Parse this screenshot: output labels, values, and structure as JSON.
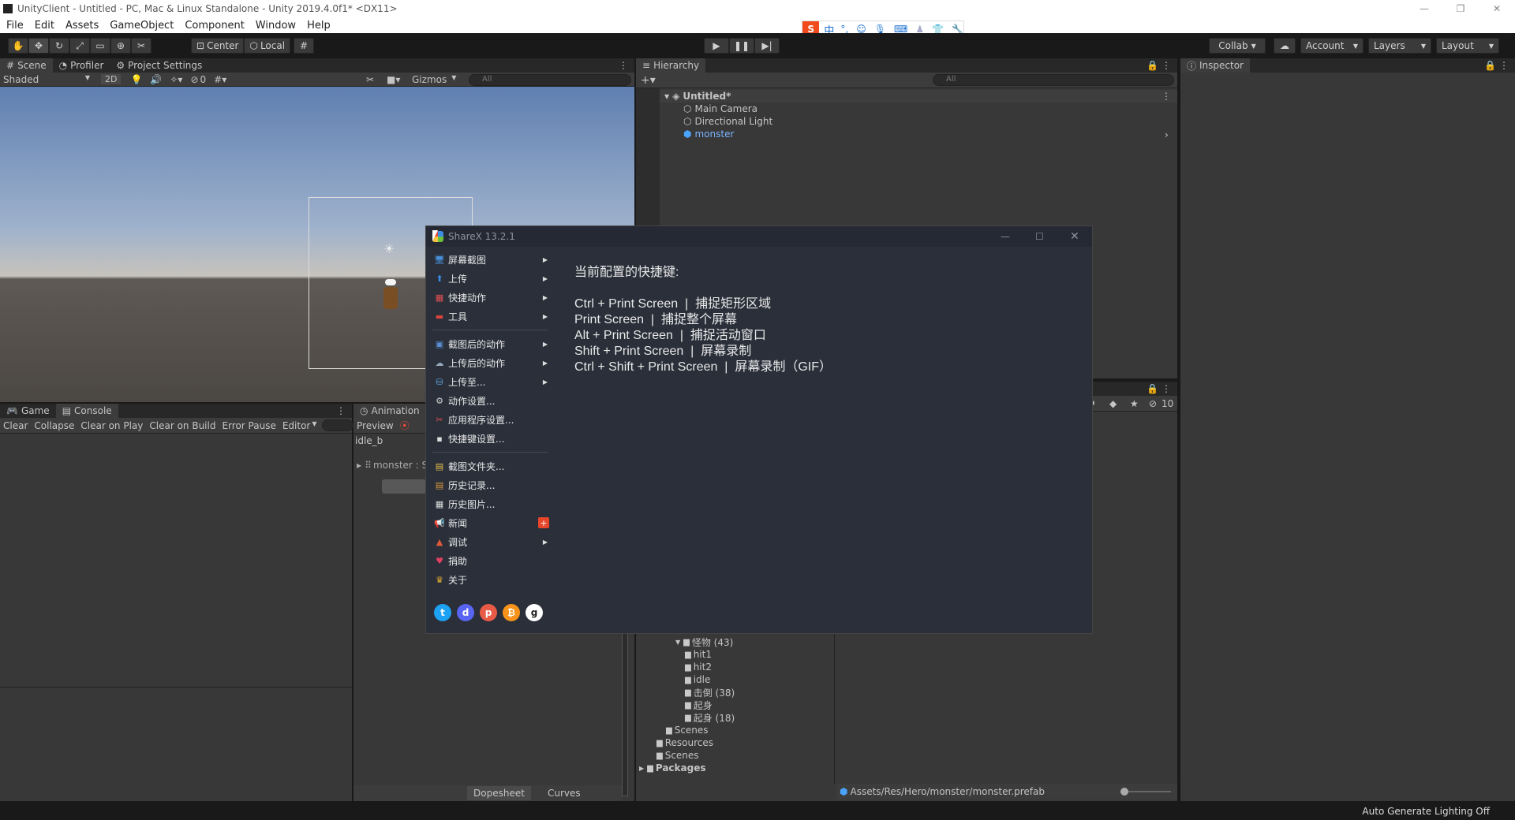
{
  "window": {
    "title": "UnityClient - Untitled - PC, Mac & Linux Standalone - Unity 2019.4.0f1* <DX11>"
  },
  "menu": [
    "File",
    "Edit",
    "Assets",
    "GameObject",
    "Component",
    "Window",
    "Help"
  ],
  "toolbar": {
    "center": "Center",
    "local": "Local",
    "collab": "Collab",
    "account": "Account",
    "layers": "Layers",
    "layout": "Layout"
  },
  "scene": {
    "tabs": [
      "Scene",
      "Profiler",
      "Project Settings"
    ],
    "shading": "Shaded",
    "mode2d": "2D",
    "hidden_count": "0",
    "gizmos": "Gizmos",
    "search_placeholder": "All"
  },
  "hierarchy": {
    "tab": "Hierarchy",
    "search_placeholder": "All",
    "scene": "Untitled*",
    "items": [
      "Main Camera",
      "Directional Light",
      "monster"
    ]
  },
  "inspector": {
    "tab": "Inspector"
  },
  "console": {
    "tabs": [
      "Game",
      "Console"
    ],
    "buttons": [
      "Clear",
      "Collapse",
      "Clear on Play",
      "Clear on Build",
      "Error Pause",
      "Editor"
    ]
  },
  "animation": {
    "tab": "Animation",
    "preview": "Preview",
    "clip": "idle_b",
    "track": "monster : S",
    "bottom_tabs": [
      "Dopesheet",
      "Curves"
    ]
  },
  "project": {
    "hidden_count": "10",
    "folders": [
      {
        "label": "怪物 (43)",
        "indent": 2
      },
      {
        "label": "hit1",
        "indent": 3
      },
      {
        "label": "hit2",
        "indent": 3
      },
      {
        "label": "idle",
        "indent": 3
      },
      {
        "label": "击倒 (38)",
        "indent": 3
      },
      {
        "label": "起身",
        "indent": 3
      },
      {
        "label": "起身 (18)",
        "indent": 3
      },
      {
        "label": "Scenes",
        "indent": 1
      },
      {
        "label": "Resources",
        "indent": 0
      },
      {
        "label": "Scenes",
        "indent": 0
      },
      {
        "label": "Packages",
        "indent": -1
      }
    ],
    "path": "Assets/Res/Hero/monster/monster.prefab"
  },
  "status": {
    "text": "Auto Generate Lighting Off"
  },
  "ime": {
    "label": "中"
  },
  "sharex": {
    "title": "ShareX 13.2.1",
    "menu": [
      {
        "label": "屏幕截图",
        "arrow": true,
        "icon": "🖥",
        "color": "#4a90d9"
      },
      {
        "label": "上传",
        "arrow": true,
        "icon": "⬆",
        "color": "#3b8ee8"
      },
      {
        "label": "快捷动作",
        "arrow": true,
        "icon": "▦",
        "color": "#e04f4f"
      },
      {
        "label": "工具",
        "arrow": true,
        "icon": "▬",
        "color": "#d9453c"
      },
      {
        "sep": true
      },
      {
        "label": "截图后的动作",
        "arrow": true,
        "icon": "▣",
        "color": "#5b8fd6"
      },
      {
        "label": "上传后的动作",
        "arrow": true,
        "icon": "☁",
        "color": "#9ab"
      },
      {
        "label": "上传至...",
        "arrow": true,
        "icon": "⛁",
        "color": "#5fa8e0"
      },
      {
        "label": "动作设置...",
        "arrow": false,
        "icon": "⚙",
        "color": "#ccc"
      },
      {
        "label": "应用程序设置...",
        "arrow": false,
        "icon": "✂",
        "color": "#e05050"
      },
      {
        "label": "快捷键设置...",
        "arrow": false,
        "icon": "▪",
        "color": "#ddd"
      },
      {
        "sep": true
      },
      {
        "label": "截图文件夹...",
        "arrow": false,
        "icon": "▤",
        "color": "#e8c24a"
      },
      {
        "label": "历史记录...",
        "arrow": false,
        "icon": "▤",
        "color": "#e09a3a"
      },
      {
        "label": "历史图片...",
        "arrow": false,
        "icon": "▦",
        "color": "#ddd"
      },
      {
        "label": "新闻",
        "arrow": false,
        "icon": "📢",
        "color": "#e05050",
        "badge": "+"
      },
      {
        "label": "调试",
        "arrow": true,
        "icon": "▲",
        "color": "#e05a3a"
      },
      {
        "label": "捐助",
        "arrow": false,
        "icon": "♥",
        "color": "#e04060"
      },
      {
        "label": "关于",
        "arrow": false,
        "icon": "♛",
        "color": "#e8b030"
      }
    ],
    "hotkeys_title": "当前配置的快捷键:",
    "hotkeys": [
      "Ctrl + Print Screen  |  捕捉矩形区域",
      "Print Screen  |  捕捉整个屏幕",
      "Alt + Print Screen  |  捕捉活动窗口",
      "Shift + Print Screen  |  屏幕录制",
      "Ctrl + Shift + Print Screen  |  屏幕录制（GIF）"
    ],
    "social": [
      {
        "name": "twitter-icon",
        "color": "#1da1f2",
        "glyph": "t"
      },
      {
        "name": "discord-icon",
        "color": "#5865f2",
        "glyph": "d"
      },
      {
        "name": "patreon-icon",
        "color": "#e85b46",
        "glyph": "p"
      },
      {
        "name": "bitcoin-icon",
        "color": "#f7931a",
        "glyph": "₿"
      },
      {
        "name": "github-icon",
        "color": "#ffffff",
        "glyph": "g"
      }
    ]
  }
}
